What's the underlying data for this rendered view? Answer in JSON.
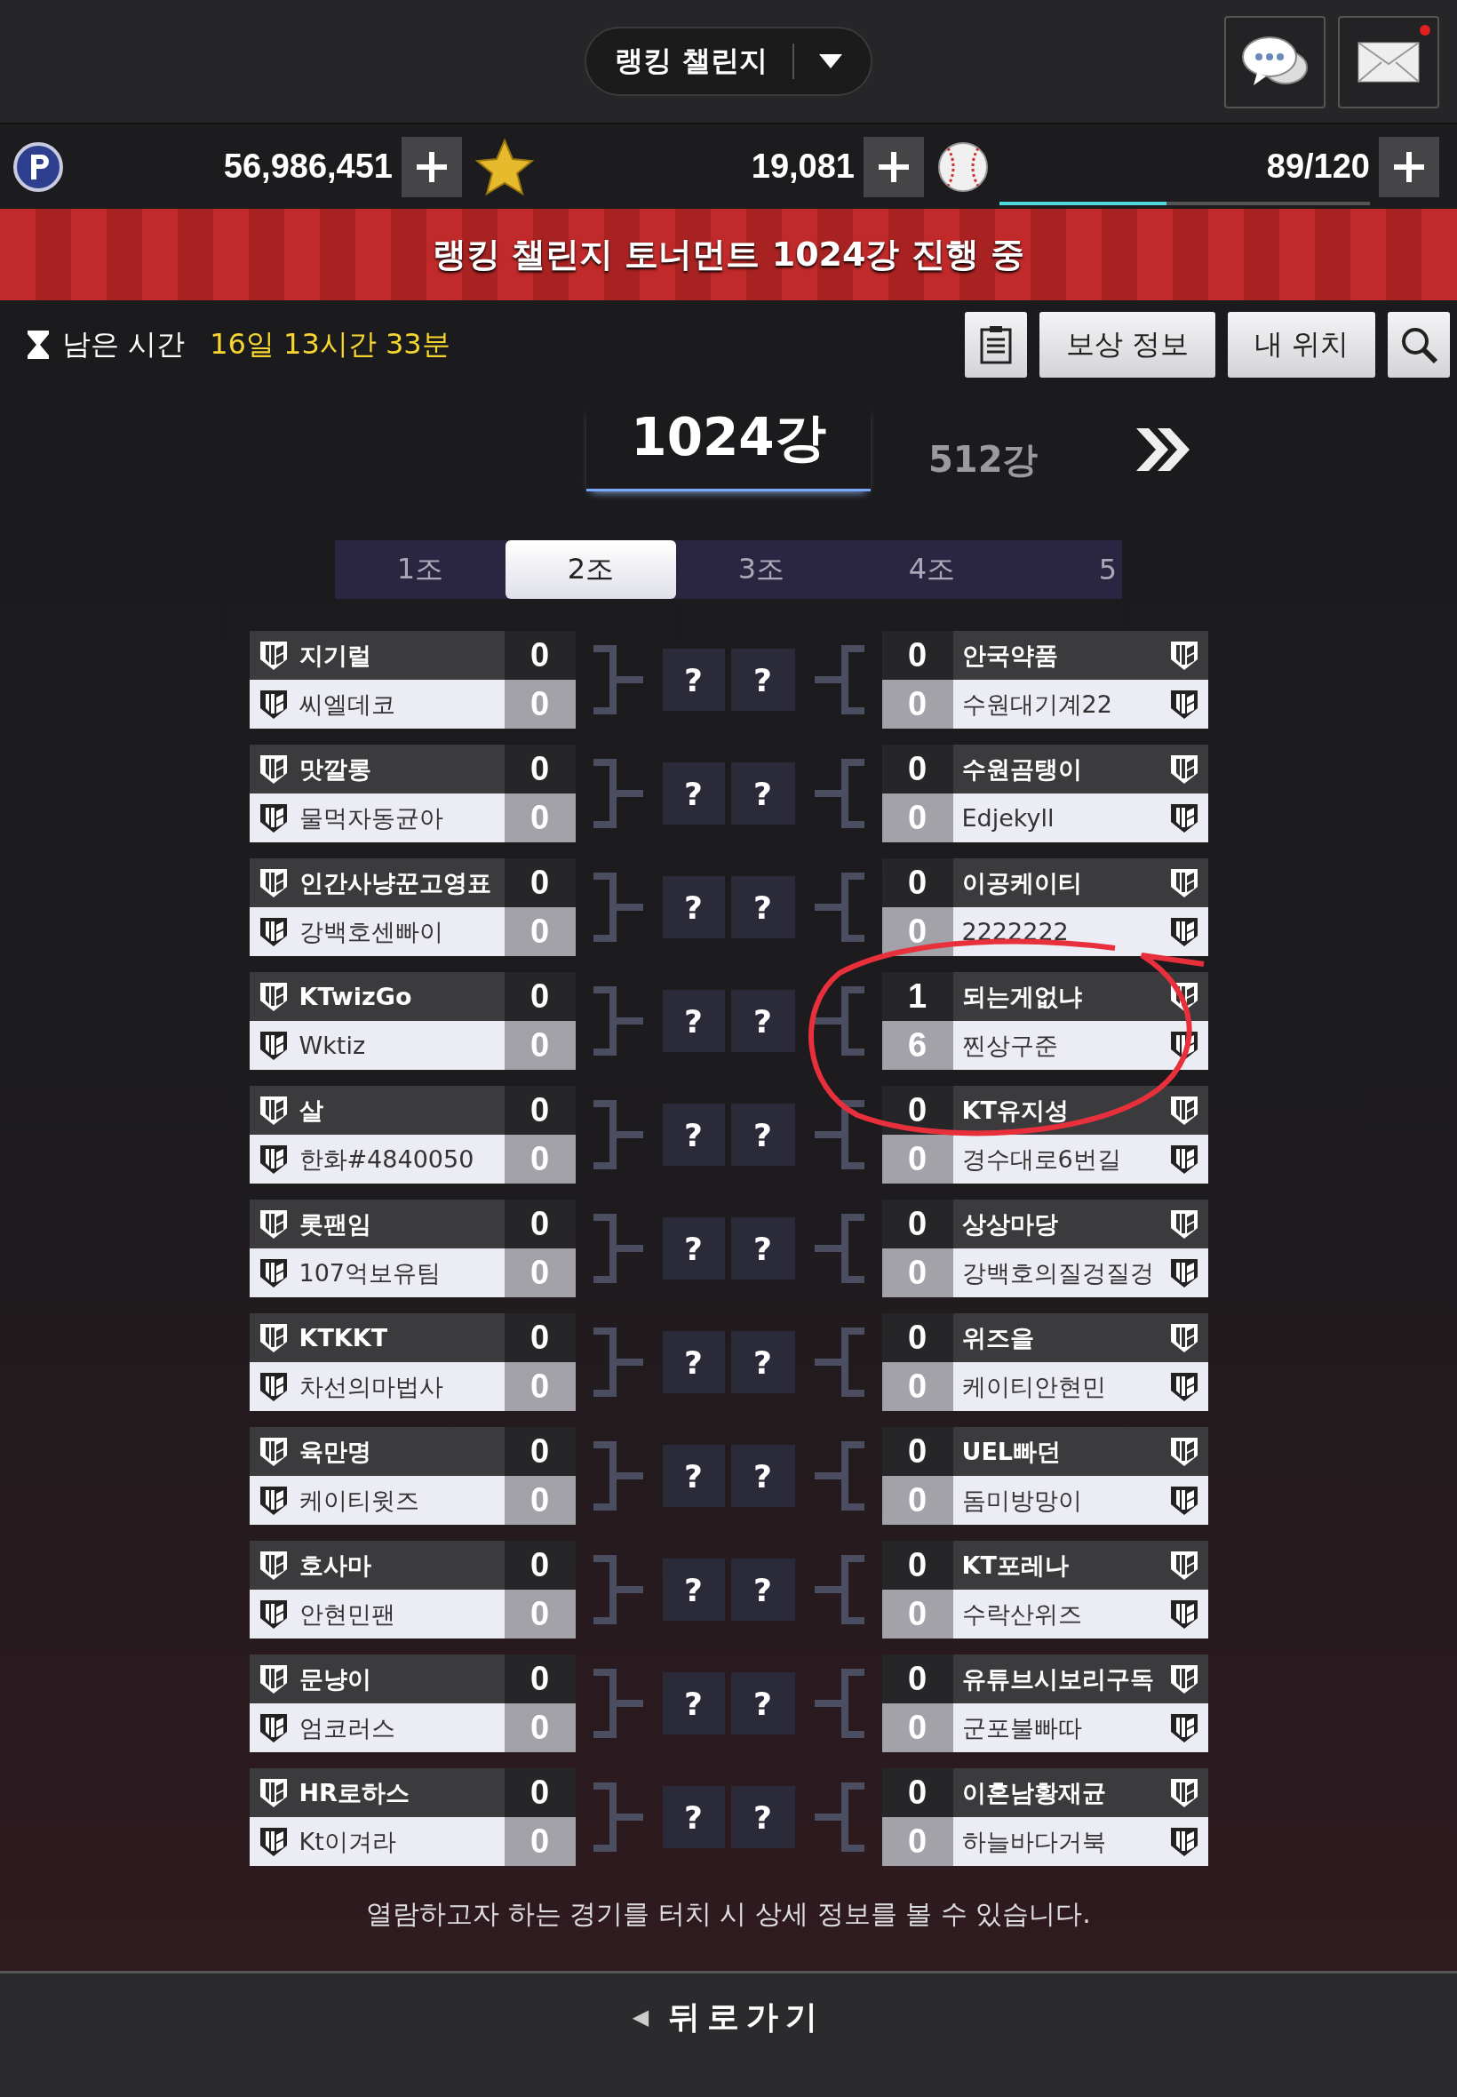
{
  "header": {
    "title": "랭킹 챌린지",
    "mail_unread": true
  },
  "currencies": [
    {
      "kind": "points",
      "value": "56,986,451"
    },
    {
      "kind": "star",
      "value": "19,081"
    },
    {
      "kind": "ball",
      "value": "89/120",
      "level": 0.45
    }
  ],
  "banner": "랭킹 챌린지 토너먼트 1024강 진행 중",
  "timer": {
    "label": "남은 시간",
    "value": "16일 13시간 33분"
  },
  "actions": [
    "보상 정보",
    "내 위치"
  ],
  "rounds": [
    {
      "label": "1024강",
      "selected": true
    },
    {
      "label": "512강",
      "selected": false
    }
  ],
  "groups": [
    {
      "label": "1조",
      "selected": false
    },
    {
      "label": "2조",
      "selected": true
    },
    {
      "label": "3조",
      "selected": false
    },
    {
      "label": "4조",
      "selected": false
    },
    {
      "label": "5",
      "selected": false
    }
  ],
  "matches": [
    {
      "left": [
        {
          "name": "지기럴",
          "score": "0"
        },
        {
          "name": "씨엘데코",
          "score": "0"
        }
      ],
      "right": [
        {
          "name": "안국약품",
          "score": "0"
        },
        {
          "name": "수원대기계22",
          "score": "0"
        }
      ]
    },
    {
      "left": [
        {
          "name": "맛깔롱",
          "score": "0"
        },
        {
          "name": "물먹자동균아",
          "score": "0"
        }
      ],
      "right": [
        {
          "name": "수원곰탱이",
          "score": "0"
        },
        {
          "name": "Edjekyll",
          "score": "0"
        }
      ]
    },
    {
      "left": [
        {
          "name": "인간사냥꾼고영표",
          "score": "0"
        },
        {
          "name": "강백호센빠이",
          "score": "0"
        }
      ],
      "right": [
        {
          "name": "이공케이티",
          "score": "0"
        },
        {
          "name": "2222222",
          "score": "0"
        }
      ]
    },
    {
      "left": [
        {
          "name": "KTwizGo",
          "score": "0"
        },
        {
          "name": "Wktiz",
          "score": "0"
        }
      ],
      "right": [
        {
          "name": "되는게없냐",
          "score": "1"
        },
        {
          "name": "찐상구준",
          "score": "6"
        }
      ]
    },
    {
      "left": [
        {
          "name": "살",
          "score": "0"
        },
        {
          "name": "한화#4840050",
          "score": "0"
        }
      ],
      "right": [
        {
          "name": "KT유지성",
          "score": "0"
        },
        {
          "name": "경수대로6번길",
          "score": "0"
        }
      ]
    },
    {
      "left": [
        {
          "name": "롯팬임",
          "score": "0"
        },
        {
          "name": "107억보유팀",
          "score": "0"
        }
      ],
      "right": [
        {
          "name": "상상마당",
          "score": "0"
        },
        {
          "name": "강백호의질겅질겅",
          "score": "0"
        }
      ]
    },
    {
      "left": [
        {
          "name": "KTKKT",
          "score": "0"
        },
        {
          "name": "차선의마법사",
          "score": "0"
        }
      ],
      "right": [
        {
          "name": "위즈을",
          "score": "0"
        },
        {
          "name": "케이티안현민",
          "score": "0"
        }
      ]
    },
    {
      "left": [
        {
          "name": "육만명",
          "score": "0"
        },
        {
          "name": "케이티윗즈",
          "score": "0"
        }
      ],
      "right": [
        {
          "name": "UEL빠던",
          "score": "0"
        },
        {
          "name": "돔미방망이",
          "score": "0"
        }
      ]
    },
    {
      "left": [
        {
          "name": "호사마",
          "score": "0"
        },
        {
          "name": "안현민팬",
          "score": "0"
        }
      ],
      "right": [
        {
          "name": "KT포레나",
          "score": "0"
        },
        {
          "name": "수락산위즈",
          "score": "0"
        }
      ]
    },
    {
      "left": [
        {
          "name": "문냥이",
          "score": "0"
        },
        {
          "name": "엄코러스",
          "score": "0"
        }
      ],
      "right": [
        {
          "name": "유튜브시보리구독",
          "score": "0"
        },
        {
          "name": "군포불빠따",
          "score": "0"
        }
      ]
    },
    {
      "left": [
        {
          "name": "HR로하스",
          "score": "0"
        },
        {
          "name": "Kt이겨라",
          "score": "0"
        }
      ],
      "right": [
        {
          "name": "이혼남황재균",
          "score": "0"
        },
        {
          "name": "하늘바다거북",
          "score": "0"
        }
      ]
    }
  ],
  "pending": [
    "?",
    "?"
  ],
  "hint": "열람하고자 하는 경기를 터치 시 상세 정보를 볼 수 있습니다.",
  "back": {
    "arrow": "◀",
    "label": "뒤로가기"
  }
}
